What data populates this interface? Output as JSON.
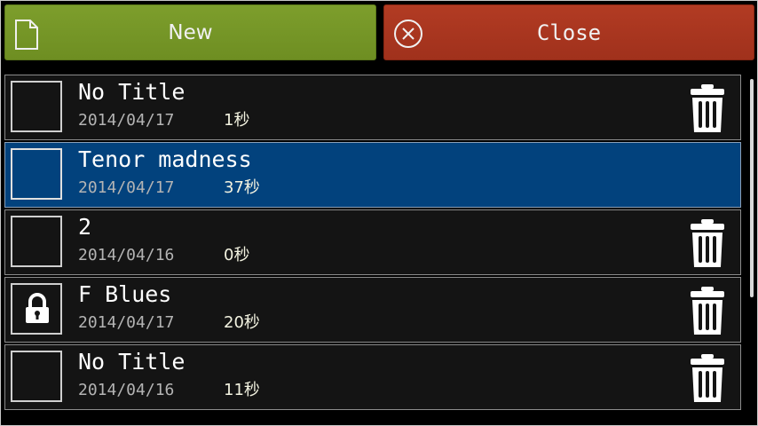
{
  "toolbar": {
    "new_label": "New",
    "new_icon": "document-icon",
    "close_label": "Close",
    "close_icon": "close-circle-icon"
  },
  "colors": {
    "new_button": "#7a9a2a",
    "close_button": "#a8351f",
    "selected_row": "#02427d",
    "row_background": "#141414"
  },
  "files": [
    {
      "title": "No Title",
      "date": "2014/04/17",
      "duration": "1秒",
      "selected": false,
      "locked": false,
      "deletable": true
    },
    {
      "title": "Tenor madness",
      "date": "2014/04/17",
      "duration": "37秒",
      "selected": true,
      "locked": false,
      "deletable": false
    },
    {
      "title": "2",
      "date": "2014/04/16",
      "duration": "0秒",
      "selected": false,
      "locked": false,
      "deletable": true
    },
    {
      "title": "F Blues",
      "date": "2014/04/17",
      "duration": "20秒",
      "selected": false,
      "locked": true,
      "deletable": true
    },
    {
      "title": "No Title",
      "date": "2014/04/16",
      "duration": "11秒",
      "selected": false,
      "locked": false,
      "deletable": true
    }
  ]
}
